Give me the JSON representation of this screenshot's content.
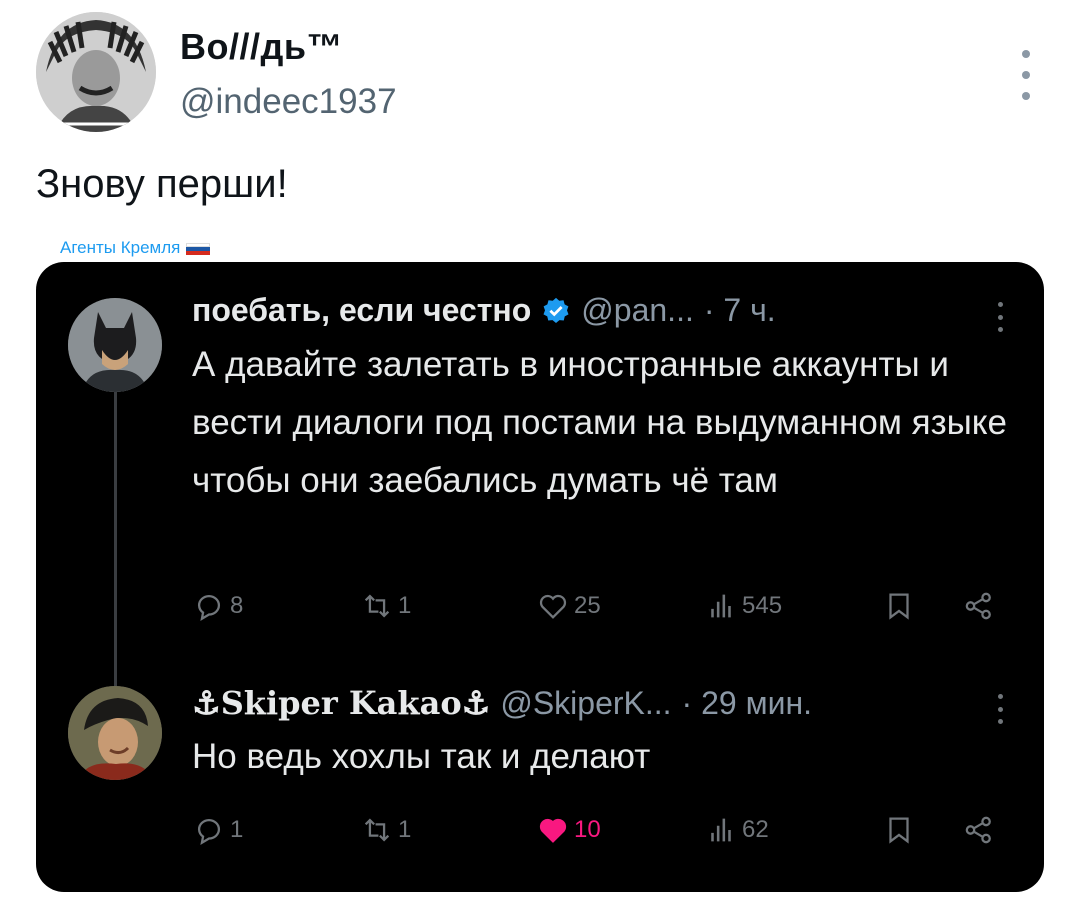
{
  "post": {
    "display_name": "Во///дь™",
    "handle": "@indeec1937",
    "text": "Знову перши!"
  },
  "embed": {
    "caption": "Агенты Кремля",
    "replies": [
      {
        "name": "поебать, если честно",
        "verified": true,
        "handle": "@pan...",
        "time": "· 7 ч.",
        "body": "А давайте залетать в иностранные аккаунты и вести диалоги под постами на выдуманном языке чтобы они заебались думать чё там",
        "stats": {
          "replies": "8",
          "reposts": "1",
          "likes": "25",
          "views": "545"
        },
        "liked": false
      },
      {
        "name": "⚓︎Skiper Kakao⚓︎",
        "verified": false,
        "handle": "@SkiperK...",
        "time": "· 29 мин.",
        "body": "Но ведь хохлы так и делают",
        "stats": {
          "replies": "1",
          "reposts": "1",
          "likes": "10",
          "views": "62"
        },
        "liked": true
      }
    ]
  },
  "colors": {
    "accent": "#1d9bf0",
    "like": "#f91880",
    "muted": "#71767b"
  }
}
